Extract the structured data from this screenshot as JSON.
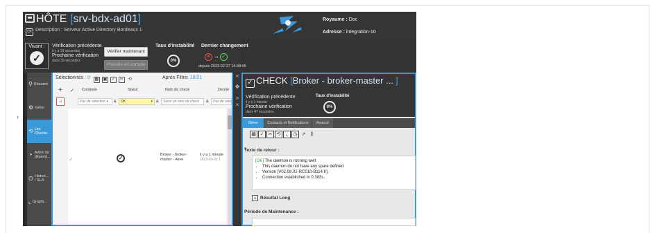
{
  "host": {
    "prefix": "HÔTE",
    "bracket_open": "[",
    "bracket_close": "]",
    "name": "srv-bdx-ad01",
    "description": "Description : Serveur Active Directory Bordeaux 1",
    "realm_label": "Royaume :",
    "realm_value": "Doc",
    "address_label": "Adresse :",
    "address_value": "integration-10"
  },
  "status": {
    "state": "Vivant :",
    "prev_check_label": "Vérification précédente",
    "prev_check_ago": "il y a 19 secondes",
    "next_check_label": "Prochaine vérification",
    "next_check_in": "dans 39 secondes",
    "verify_now": "Vérifier maintenant",
    "acknowledge": "Prendre en compte",
    "instability_label": "Taux d'instabilité",
    "instability_value": "0%",
    "last_change_label": "Dernier changement",
    "last_change_since": "depuis 2023-02-27 16:38:05"
  },
  "sidebar": {
    "items": [
      {
        "label": "Résumé",
        "icon": "search-icon"
      },
      {
        "label": "Gérer",
        "icon": "gears-icon"
      },
      {
        "label": "Les Checks",
        "icon": "refresh-icon"
      },
      {
        "label": "Arbre de dépend...",
        "icon": "tree-icon"
      },
      {
        "label": "Histori... / SLA",
        "icon": "history-icon"
      },
      {
        "label": "Graphi...",
        "icon": "chart-icon"
      }
    ]
  },
  "checks": {
    "selected_label": "Sélectionnés :",
    "selected_count": "0",
    "after_filter_label": "Après Filtre:",
    "after_filter_value": "18/21",
    "columns": [
      "Contexte",
      "Statut",
      "Nom de check",
      "Derniè"
    ],
    "filters": {
      "context": "Pas de sélection ▾",
      "status": "OK",
      "name_placeholder": "Saisir un nom de check",
      "last": "Pas de séle",
      "amp": "&"
    },
    "row": {
      "name": "Broker - broker-master - Alive",
      "time": "il y a 1 minute",
      "date": "2023-03-02 1"
    }
  },
  "check_panel": {
    "prefix": "CHECK",
    "bracket_open": "[",
    "name": "Broker - broker-master ...",
    "bracket_close": "]",
    "prev_check_label": "Vérification précédente",
    "prev_check_ago": "il y a 1 minute",
    "next_check_label": "Prochaine vérification",
    "next_check_in": "dans 47 secondes",
    "instability_label": "Taux d'instabilité",
    "instability_value": "0%",
    "tabs": [
      "Gérer",
      "Contacts et Notifications",
      "Avancé"
    ],
    "output_label": "Texte de retour :",
    "output_ok": "[OK]",
    "output_head": "The daemon is running well:",
    "output_lines": [
      "This daemon do not have any spare defined",
      "Version [V02.08.02-RC010-B114.fr].",
      "Connection established in 0.383s."
    ],
    "long_result_label": "Résultat Long",
    "maintenance_label": "Période de Maintenance :"
  },
  "colors": {
    "accent": "#3a9ad9",
    "ok": "#5bd35b",
    "critical": "#e05050"
  }
}
